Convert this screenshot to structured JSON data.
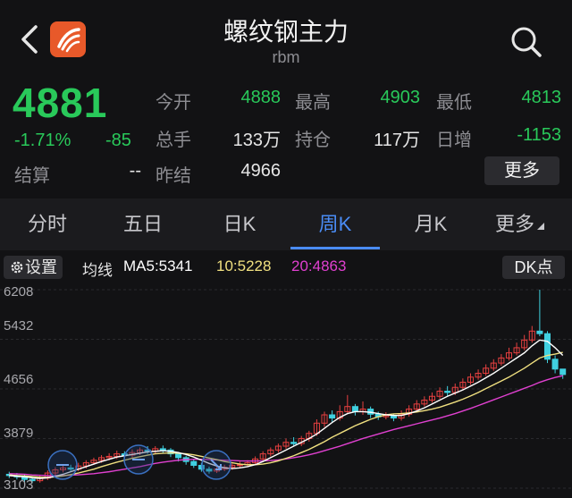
{
  "header": {
    "title": "螺纹钢主力",
    "code": "rbm",
    "back_icon": "chevron-left-icon",
    "search_icon": "search-icon",
    "logo_color": "#e8592a"
  },
  "quote": {
    "price": "4881",
    "change_pct": "-1.71%",
    "change_val": "-85",
    "open_label": "今开",
    "open": "4888",
    "high_label": "最高",
    "high": "4903",
    "low_label": "最低",
    "low": "4813",
    "volume_label": "总手",
    "volume": "133万",
    "oi_label": "持仓",
    "oi": "117万",
    "daily_inc_label": "日增",
    "daily_inc": "-1153",
    "settle_label": "结算",
    "settle": "--",
    "prev_settle_label": "昨结",
    "prev_settle": "4966",
    "more_label": "更多"
  },
  "tabs": [
    {
      "label": "分时",
      "active": false
    },
    {
      "label": "五日",
      "active": false
    },
    {
      "label": "日K",
      "active": false
    },
    {
      "label": "周K",
      "active": true
    },
    {
      "label": "月K",
      "active": false
    },
    {
      "label": "更多",
      "active": false
    }
  ],
  "ma_bar": {
    "settings_label": "设置",
    "type_label": "均线",
    "ma5": "MA5:5341",
    "ma10": "10:5228",
    "ma20": "20:4863",
    "dk_label": "DK点",
    "colors": {
      "ma5": "#ffffff",
      "ma10": "#f0e080",
      "ma20": "#e040d0"
    }
  },
  "chart_data": {
    "type": "candlestick",
    "y_ticks": [
      "6208",
      "5432",
      "4656",
      "3879",
      "3103"
    ],
    "ylim": [
      3103,
      6208
    ],
    "up_color": "#e84040",
    "down_color": "#40d0e0",
    "candles": [
      [
        3320,
        3300,
        3360,
        3260
      ],
      [
        3300,
        3280,
        3340,
        3240
      ],
      [
        3280,
        3240,
        3320,
        3200
      ],
      [
        3240,
        3220,
        3290,
        3180
      ],
      [
        3220,
        3260,
        3310,
        3190
      ],
      [
        3260,
        3340,
        3380,
        3230
      ],
      [
        3340,
        3390,
        3430,
        3300
      ],
      [
        3390,
        3420,
        3470,
        3350
      ],
      [
        3420,
        3400,
        3470,
        3360
      ],
      [
        3400,
        3450,
        3500,
        3370
      ],
      [
        3450,
        3500,
        3540,
        3410
      ],
      [
        3500,
        3540,
        3580,
        3470
      ],
      [
        3540,
        3580,
        3620,
        3500
      ],
      [
        3580,
        3600,
        3650,
        3540
      ],
      [
        3600,
        3640,
        3690,
        3560
      ],
      [
        3640,
        3620,
        3680,
        3560
      ],
      [
        3620,
        3660,
        3710,
        3580
      ],
      [
        3660,
        3700,
        3740,
        3620
      ],
      [
        3700,
        3680,
        3760,
        3640
      ],
      [
        3680,
        3720,
        3760,
        3640
      ],
      [
        3720,
        3700,
        3770,
        3650
      ],
      [
        3700,
        3640,
        3730,
        3590
      ],
      [
        3640,
        3580,
        3670,
        3520
      ],
      [
        3580,
        3520,
        3610,
        3470
      ],
      [
        3520,
        3460,
        3560,
        3420
      ],
      [
        3460,
        3400,
        3500,
        3360
      ],
      [
        3400,
        3370,
        3440,
        3330
      ],
      [
        3370,
        3400,
        3440,
        3340
      ],
      [
        3400,
        3430,
        3470,
        3370
      ],
      [
        3430,
        3460,
        3490,
        3390
      ],
      [
        3460,
        3470,
        3520,
        3420
      ],
      [
        3470,
        3500,
        3540,
        3440
      ],
      [
        3500,
        3560,
        3600,
        3460
      ],
      [
        3560,
        3640,
        3680,
        3520
      ],
      [
        3640,
        3700,
        3740,
        3600
      ],
      [
        3700,
        3760,
        3800,
        3660
      ],
      [
        3760,
        3820,
        3880,
        3720
      ],
      [
        3820,
        3800,
        3900,
        3760
      ],
      [
        3800,
        3880,
        3920,
        3760
      ],
      [
        3880,
        3960,
        4000,
        3830
      ],
      [
        3960,
        4120,
        4180,
        3920
      ],
      [
        4120,
        4250,
        4300,
        4060
      ],
      [
        4250,
        4200,
        4320,
        4140
      ],
      [
        4200,
        4300,
        4400,
        4160
      ],
      [
        4300,
        4380,
        4560,
        4260
      ],
      [
        4380,
        4300,
        4420,
        4240
      ],
      [
        4300,
        4340,
        4460,
        4250
      ],
      [
        4340,
        4260,
        4380,
        4200
      ],
      [
        4260,
        4220,
        4300,
        4170
      ],
      [
        4220,
        4240,
        4290,
        4180
      ],
      [
        4240,
        4200,
        4270,
        4150
      ],
      [
        4200,
        4260,
        4320,
        4160
      ],
      [
        4260,
        4340,
        4400,
        4220
      ],
      [
        4340,
        4420,
        4480,
        4300
      ],
      [
        4420,
        4480,
        4540,
        4380
      ],
      [
        4480,
        4540,
        4600,
        4440
      ],
      [
        4540,
        4620,
        4680,
        4500
      ],
      [
        4620,
        4600,
        4700,
        4540
      ],
      [
        4600,
        4680,
        4740,
        4560
      ],
      [
        4680,
        4760,
        4820,
        4640
      ],
      [
        4760,
        4840,
        4900,
        4720
      ],
      [
        4840,
        4900,
        4960,
        4800
      ],
      [
        4900,
        4980,
        5040,
        4860
      ],
      [
        4980,
        5060,
        5120,
        4940
      ],
      [
        5060,
        5140,
        5200,
        5020
      ],
      [
        5140,
        5220,
        5300,
        5100
      ],
      [
        5220,
        5300,
        5380,
        5180
      ],
      [
        5300,
        5420,
        5500,
        5260
      ],
      [
        5420,
        5560,
        5640,
        5380
      ],
      [
        5560,
        5520,
        6208,
        5480
      ],
      [
        5520,
        5120,
        5560,
        5060
      ],
      [
        5120,
        4966,
        5180,
        4900
      ],
      [
        4966,
        4881,
        4903,
        4813
      ]
    ],
    "ma5": [
      3300,
      3290,
      3280,
      3265,
      3255,
      3265,
      3290,
      3320,
      3360,
      3400,
      3440,
      3480,
      3520,
      3555,
      3590,
      3610,
      3630,
      3650,
      3670,
      3680,
      3690,
      3680,
      3660,
      3630,
      3590,
      3540,
      3490,
      3450,
      3420,
      3410,
      3420,
      3440,
      3470,
      3520,
      3580,
      3640,
      3700,
      3760,
      3820,
      3880,
      3950,
      4040,
      4130,
      4210,
      4270,
      4300,
      4300,
      4290,
      4270,
      4250,
      4240,
      4240,
      4270,
      4310,
      4360,
      4420,
      4480,
      4540,
      4590,
      4640,
      4700,
      4760,
      4830,
      4900,
      4980,
      5060,
      5140,
      5220,
      5330,
      5420,
      5400,
      5300,
      5180
    ],
    "ma10": [
      3310,
      3300,
      3295,
      3285,
      3275,
      3272,
      3280,
      3295,
      3315,
      3340,
      3370,
      3400,
      3440,
      3475,
      3510,
      3540,
      3570,
      3595,
      3620,
      3640,
      3650,
      3655,
      3650,
      3640,
      3625,
      3600,
      3575,
      3550,
      3520,
      3500,
      3480,
      3470,
      3470,
      3480,
      3500,
      3530,
      3570,
      3610,
      3660,
      3710,
      3770,
      3830,
      3900,
      3960,
      4020,
      4080,
      4130,
      4180,
      4220,
      4250,
      4265,
      4270,
      4280,
      4295,
      4315,
      4340,
      4370,
      4410,
      4450,
      4495,
      4545,
      4600,
      4660,
      4720,
      4780,
      4840,
      4910,
      4980,
      5060,
      5140,
      5180,
      5200,
      5228
    ],
    "ma20": [
      3330,
      3325,
      3320,
      3310,
      3305,
      3300,
      3300,
      3302,
      3306,
      3312,
      3320,
      3330,
      3345,
      3360,
      3380,
      3400,
      3420,
      3440,
      3465,
      3490,
      3510,
      3525,
      3540,
      3550,
      3555,
      3555,
      3550,
      3545,
      3540,
      3535,
      3530,
      3528,
      3528,
      3530,
      3535,
      3545,
      3560,
      3580,
      3600,
      3625,
      3655,
      3690,
      3725,
      3760,
      3800,
      3840,
      3880,
      3915,
      3950,
      3985,
      4020,
      4050,
      4080,
      4110,
      4140,
      4170,
      4200,
      4235,
      4270,
      4310,
      4350,
      4395,
      4440,
      4485,
      4530,
      4575,
      4620,
      4665,
      4710,
      4760,
      4800,
      4835,
      4863
    ]
  }
}
